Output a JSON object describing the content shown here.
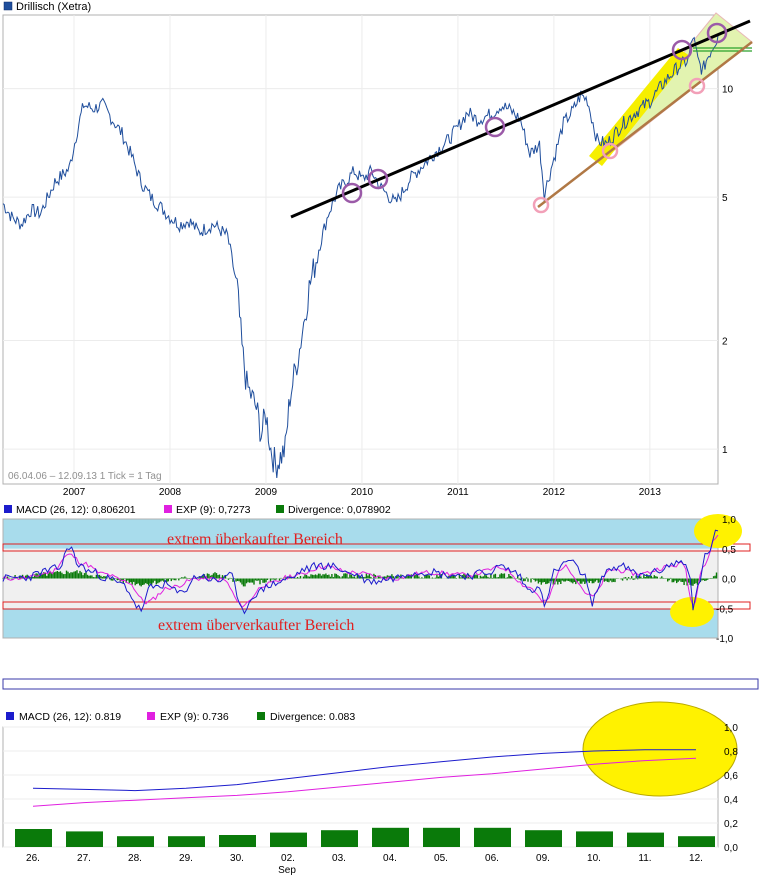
{
  "colors": {
    "price_line": "#1f4e9c",
    "macd_line": "#1c1ccc",
    "exp_line": "#e020e0",
    "divergence": "#0a7a0a",
    "extreme_band": "#a8dcec",
    "trend_black": "#000000",
    "trend_brown": "#b07845",
    "channel_yellow": "#f6ef00",
    "channel_pale": "#e2f3b0",
    "circle_purple": "#9b5aa8",
    "circle_pink": "#f2a0b8",
    "annotation_red": "#e02020",
    "highlight_yellow": "#fff200"
  },
  "charts": {
    "price": {
      "legend_icon": "blue-square",
      "legend": "Drillisch (Xetra)",
      "info": "06.04.06 – 12.09.13   1 Tick = 1 Tag",
      "xticks": [
        "2007",
        "2008",
        "2009",
        "2010",
        "2011",
        "2012",
        "2013"
      ],
      "yticks": [
        "10",
        "5",
        "2",
        "1"
      ]
    },
    "macd_long": {
      "legend": [
        {
          "label": "MACD (26, 12): 0,806201",
          "color": "#1c1ccc"
        },
        {
          "label": "EXP (9): 0,7273",
          "color": "#e020e0"
        },
        {
          "label": "Divergence: 0,078902",
          "color": "#0a7a0a"
        }
      ],
      "yticks": [
        "1,0",
        "0,5",
        "0,0",
        "-0,5",
        "-1,0"
      ],
      "note_top": "extrem überkaufter Bereich",
      "note_bottom": "extrem überverkaufter Bereich"
    },
    "macd_short": {
      "legend": [
        {
          "label": "MACD (26, 12): 0.819",
          "color": "#1c1ccc"
        },
        {
          "label": "EXP (9): 0.736",
          "color": "#e020e0"
        },
        {
          "label": "Divergence: 0.083",
          "color": "#0a7a0a"
        }
      ],
      "yticks": [
        "1,0",
        "0,8",
        "0,6",
        "0,4",
        "0,2",
        "0,0"
      ],
      "month_label": "Sep"
    }
  },
  "chart_data": [
    {
      "type": "line",
      "title": "Drillisch (Xetra)",
      "period": "06.04.06 – 12.09.13",
      "y_scale": "log",
      "ylim": [
        0.8,
        16
      ],
      "x_range": [
        2006.26,
        2013.71
      ],
      "x_ticks": [
        2007,
        2008,
        2009,
        2010,
        2011,
        2012,
        2013
      ],
      "y_ticks": [
        10,
        5,
        2,
        1
      ],
      "series": [
        {
          "name": "Drillisch (Xetra)",
          "x": [
            2006.26,
            2006.35,
            2006.45,
            2006.55,
            2006.65,
            2006.8,
            2006.95,
            2007.05,
            2007.1,
            2007.2,
            2007.3,
            2007.4,
            2007.5,
            2007.6,
            2007.7,
            2007.8,
            2007.9,
            2008.0,
            2008.1,
            2008.2,
            2008.3,
            2008.45,
            2008.6,
            2008.7,
            2008.75,
            2008.8,
            2008.9,
            2008.95,
            2009.0,
            2009.05,
            2009.1,
            2009.15,
            2009.2,
            2009.25,
            2009.35,
            2009.45,
            2009.55,
            2009.65,
            2009.75,
            2009.85,
            2009.92,
            2010.0,
            2010.1,
            2010.2,
            2010.35,
            2010.5,
            2010.6,
            2010.75,
            2010.9,
            2011.0,
            2011.1,
            2011.2,
            2011.35,
            2011.45,
            2011.55,
            2011.65,
            2011.75,
            2011.85,
            2011.9,
            2012.0,
            2012.1,
            2012.2,
            2012.28,
            2012.35,
            2012.45,
            2012.55,
            2012.7,
            2012.85,
            2013.0,
            2013.1,
            2013.2,
            2013.3,
            2013.4,
            2013.45,
            2013.5,
            2013.55,
            2013.6,
            2013.71
          ],
          "values": [
            4.8,
            4.4,
            4.2,
            4.6,
            4.5,
            5.5,
            6.0,
            8.0,
            9.0,
            8.8,
            9.0,
            8.2,
            7.5,
            6.5,
            5.5,
            5.0,
            4.7,
            4.4,
            4.2,
            4.3,
            4.0,
            4.2,
            3.9,
            2.8,
            1.9,
            1.5,
            1.3,
            1.1,
            1.25,
            1.0,
            0.9,
            0.95,
            1.0,
            1.4,
            1.9,
            2.8,
            3.6,
            4.5,
            5.2,
            5.6,
            5.9,
            5.6,
            5.9,
            5.3,
            4.8,
            5.6,
            6.0,
            6.6,
            7.2,
            7.8,
            8.6,
            8.2,
            8.5,
            9.0,
            8.7,
            8.2,
            6.6,
            7.0,
            5.1,
            6.4,
            8.0,
            8.7,
            9.6,
            9.3,
            7.2,
            7.0,
            7.9,
            8.6,
            9.2,
            10.0,
            10.8,
            11.5,
            12.0,
            14.0,
            12.0,
            11.2,
            12.2,
            14.0
          ]
        }
      ]
    },
    {
      "type": "line",
      "title": "",
      "ylim": [
        -1.0,
        1.0
      ],
      "x_range": [
        2006.26,
        2013.71
      ],
      "y_ticks": [
        1.0,
        0.5,
        0.0,
        -0.5,
        -1.0
      ],
      "extreme_zones": {
        "overbought": 0.5,
        "oversold": -0.5
      },
      "series": [
        {
          "name": "MACD (26, 12)",
          "x": [
            2006.26,
            2006.5,
            2006.7,
            2006.85,
            2006.95,
            2007.05,
            2007.2,
            2007.35,
            2007.5,
            2007.7,
            2007.8,
            2007.95,
            2008.1,
            2008.3,
            2008.5,
            2008.62,
            2008.75,
            2008.9,
            2009.05,
            2009.25,
            2009.4,
            2009.55,
            2009.7,
            2009.9,
            2010.1,
            2010.3,
            2010.5,
            2010.7,
            2010.9,
            2011.1,
            2011.3,
            2011.45,
            2011.6,
            2011.75,
            2011.85,
            2011.9,
            2012.0,
            2012.15,
            2012.3,
            2012.4,
            2012.45,
            2012.55,
            2012.7,
            2012.9,
            2013.05,
            2013.2,
            2013.35,
            2013.42,
            2013.45,
            2013.5,
            2013.6,
            2013.71
          ],
          "values": [
            0.0,
            0.02,
            0.12,
            0.18,
            0.55,
            0.22,
            0.1,
            0.0,
            -0.1,
            -0.52,
            -0.15,
            -0.1,
            -0.25,
            0.05,
            -0.05,
            0.1,
            -0.55,
            -0.25,
            -0.1,
            0.0,
            0.15,
            0.22,
            0.2,
            0.08,
            -0.05,
            0.0,
            0.1,
            0.12,
            0.06,
            0.05,
            0.1,
            0.2,
            0.1,
            -0.2,
            -0.1,
            -0.5,
            0.1,
            0.3,
            0.1,
            -0.4,
            -0.2,
            0.15,
            0.2,
            0.05,
            0.1,
            0.22,
            0.3,
            0.0,
            -0.55,
            -0.1,
            0.45,
            0.8
          ]
        },
        {
          "name": "EXP (9)",
          "x": [
            2006.26,
            2006.5,
            2006.75,
            2006.95,
            2007.1,
            2007.3,
            2007.55,
            2007.75,
            2008.0,
            2008.3,
            2008.55,
            2008.75,
            2009.0,
            2009.3,
            2009.6,
            2009.9,
            2010.3,
            2010.7,
            2011.1,
            2011.45,
            2011.75,
            2011.9,
            2012.1,
            2012.4,
            2012.6,
            2012.9,
            2013.2,
            2013.35,
            2013.45,
            2013.55,
            2013.71
          ],
          "values": [
            0.0,
            0.01,
            0.1,
            0.4,
            0.25,
            0.08,
            -0.05,
            -0.4,
            -0.15,
            0.0,
            -0.02,
            -0.45,
            -0.1,
            0.05,
            0.2,
            0.1,
            0.0,
            0.1,
            0.06,
            0.18,
            -0.15,
            -0.4,
            0.2,
            -0.3,
            0.15,
            0.08,
            0.2,
            0.25,
            -0.45,
            0.2,
            0.73
          ]
        },
        {
          "name": "Divergence",
          "x": [
            2006.26,
            2007.0,
            2007.7,
            2008.5,
            2008.75,
            2009.5,
            2010.5,
            2011.5,
            2011.9,
            2012.4,
            2013.0,
            2013.45,
            2013.71
          ],
          "values": [
            0.0,
            0.12,
            -0.1,
            0.08,
            -0.1,
            0.06,
            0.03,
            0.05,
            -0.08,
            -0.06,
            0.04,
            -0.1,
            0.08
          ]
        }
      ]
    },
    {
      "type": "bar",
      "title": "",
      "categories": [
        "26.",
        "27.",
        "28.",
        "29.",
        "30.",
        "02.",
        "03.",
        "04.",
        "05.",
        "06.",
        "09.",
        "10.",
        "11.",
        "12."
      ],
      "ylim": [
        0.0,
        1.0
      ],
      "y_ticks": [
        1.0,
        0.8,
        0.6,
        0.4,
        0.2,
        0.0
      ],
      "series": [
        {
          "name": "MACD (26, 12)",
          "values": [
            0.49,
            0.48,
            0.47,
            0.49,
            0.52,
            0.57,
            0.62,
            0.67,
            0.71,
            0.75,
            0.78,
            0.8,
            0.81,
            0.81
          ]
        },
        {
          "name": "EXP (9)",
          "values": [
            0.34,
            0.37,
            0.39,
            0.41,
            0.43,
            0.46,
            0.5,
            0.54,
            0.58,
            0.61,
            0.65,
            0.69,
            0.72,
            0.74
          ]
        },
        {
          "name": "Divergence",
          "values": [
            0.15,
            0.13,
            0.09,
            0.09,
            0.1,
            0.12,
            0.14,
            0.16,
            0.16,
            0.16,
            0.14,
            0.13,
            0.12,
            0.09
          ]
        }
      ]
    }
  ]
}
